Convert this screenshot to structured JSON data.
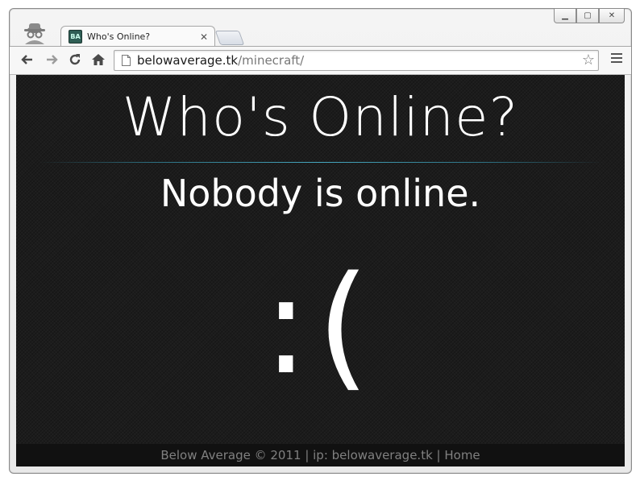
{
  "browser": {
    "tab_title": "Who's Online?",
    "favicon_text": "BA",
    "url_host": "belowaverage.tk",
    "url_path": "/minecraft/"
  },
  "page": {
    "heading": "Who's Online?",
    "status": "Nobody is online.",
    "emoticon": ":(",
    "footer": {
      "copyright": "Below Average © 2011",
      "sep1": " | ",
      "ip": "ip: belowaverage.tk",
      "sep2": " | ",
      "home_link": "Home"
    }
  },
  "icons": [
    "incognito-icon",
    "back-icon",
    "forward-icon",
    "reload-icon",
    "home-icon",
    "page-icon",
    "star-icon",
    "menu-icon",
    "close-icon"
  ],
  "colors": {
    "page_bg": "#1c1c1c",
    "text": "#ffffff",
    "footer_text": "#808080",
    "accent_rule": "#46a8c0"
  }
}
